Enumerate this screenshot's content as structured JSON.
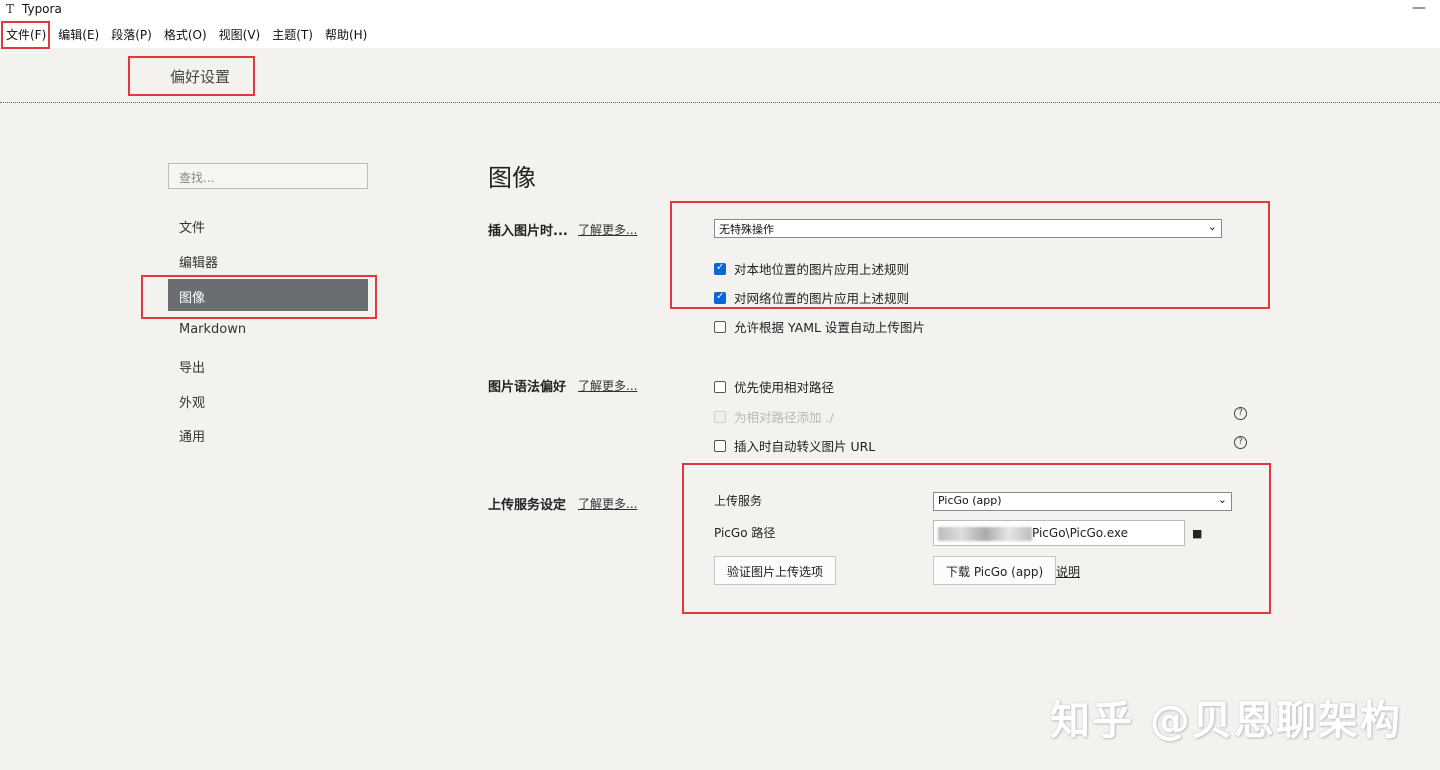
{
  "window": {
    "app_icon": "T",
    "title": "Typora",
    "minimize": "—"
  },
  "menu": [
    "文件(F)",
    "编辑(E)",
    "段落(P)",
    "格式(O)",
    "视图(V)",
    "主题(T)",
    "帮助(H)"
  ],
  "preferences_title": "偏好设置",
  "sidebar": {
    "search_placeholder": "查找...",
    "items": [
      "文件",
      "编辑器",
      "图像",
      "Markdown",
      "导出",
      "外观",
      "通用"
    ],
    "active_index": 2
  },
  "main": {
    "section_title": "图像",
    "insert": {
      "label": "插入图片时...",
      "more": "了解更多...",
      "select_value": "无特殊操作",
      "options": [
        {
          "label": "对本地位置的图片应用上述规则",
          "checked": true
        },
        {
          "label": "对网络位置的图片应用上述规则",
          "checked": true
        },
        {
          "label": "允许根据 YAML 设置自动上传图片",
          "checked": false
        }
      ]
    },
    "syntax": {
      "label": "图片语法偏好",
      "more": "了解更多...",
      "options": [
        {
          "label": "优先使用相对路径",
          "checked": false,
          "disabled": false
        },
        {
          "label": "为相对路径添加 ./",
          "checked": false,
          "disabled": true
        },
        {
          "label": "插入时自动转义图片 URL",
          "checked": false,
          "disabled": false
        }
      ],
      "help_icon": "?"
    },
    "upload": {
      "label": "上传服务设定",
      "more": "了解更多...",
      "service_label": "上传服务",
      "service_value": "PicGo (app)",
      "path_label": "PicGo 路径",
      "path_value": "PicGo\\PicGo.exe",
      "verify_button": "验证图片上传选项",
      "download_button": "下载 PicGo (app)",
      "help_link": "说明"
    }
  },
  "watermark": "知乎 @贝恩聊架构",
  "colors": {
    "background": "#f3f2ef",
    "active_nav": "#6a6e70",
    "highlight_box": "#e03a3e",
    "checkbox": "#0a66d6"
  }
}
